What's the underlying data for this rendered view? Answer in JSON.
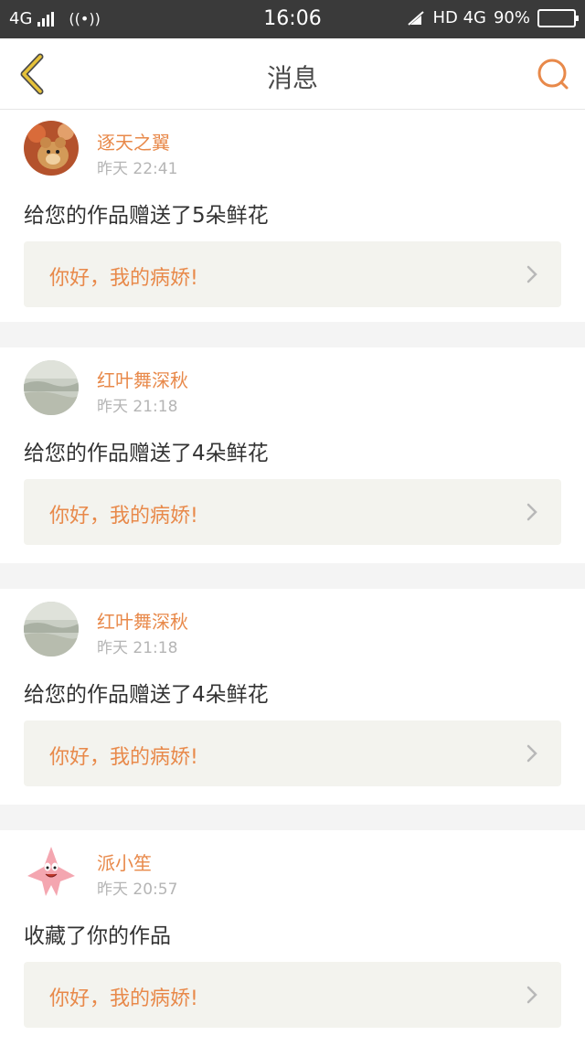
{
  "status_bar": {
    "network": "4G",
    "time": "16:06",
    "right_network": "HD 4G",
    "battery": "90%",
    "battery_level": 0.9
  },
  "header": {
    "title": "消息",
    "back_icon": "chevron-left-icon",
    "search_icon": "search-icon"
  },
  "colors": {
    "accent": "#e8894a",
    "back_icon": "#e6c23a",
    "quote_bg": "#f3f3ee"
  },
  "messages": [
    {
      "name": "逐天之翼",
      "time": "昨天 22:41",
      "text": "给您的作品赠送了5朵鲜花",
      "quote": "你好，我的病娇!",
      "avatar": "teddy-bear-avatar"
    },
    {
      "name": "红叶舞深秋",
      "time": "昨天 21:18",
      "text": "给您的作品赠送了4朵鲜花",
      "quote": "你好，我的病娇!",
      "avatar": "landscape-avatar"
    },
    {
      "name": "红叶舞深秋",
      "time": "昨天 21:18",
      "text": "给您的作品赠送了4朵鲜花",
      "quote": "你好，我的病娇!",
      "avatar": "landscape-avatar"
    },
    {
      "name": "派小笙",
      "time": "昨天 20:57",
      "text": "收藏了你的作品",
      "quote": "你好，我的病娇!",
      "avatar": "patrick-star-avatar"
    }
  ]
}
